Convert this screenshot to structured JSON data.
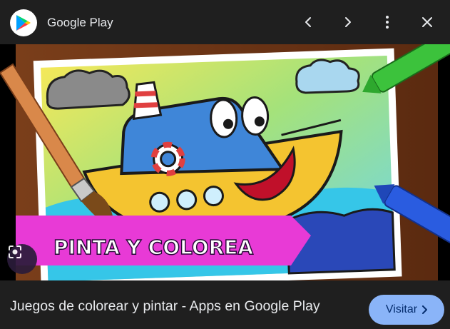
{
  "header": {
    "title": "Google Play",
    "logo_icon": "google-play-logo",
    "prev_icon": "chevron-left-icon",
    "next_icon": "chevron-right-icon",
    "menu_icon": "more-vert-icon",
    "close_icon": "close-icon"
  },
  "image": {
    "banner_text": "PINTA Y COLOREA",
    "lens_icon": "google-lens-icon"
  },
  "footer": {
    "caption": "Juegos de colorear y pintar - Apps en Google Play",
    "visit_label": "Visitar",
    "visit_icon": "chevron-right-icon"
  },
  "colors": {
    "background": "#1f1f1f",
    "accent": "#8ab4f8",
    "banner": "#e83ad6"
  }
}
